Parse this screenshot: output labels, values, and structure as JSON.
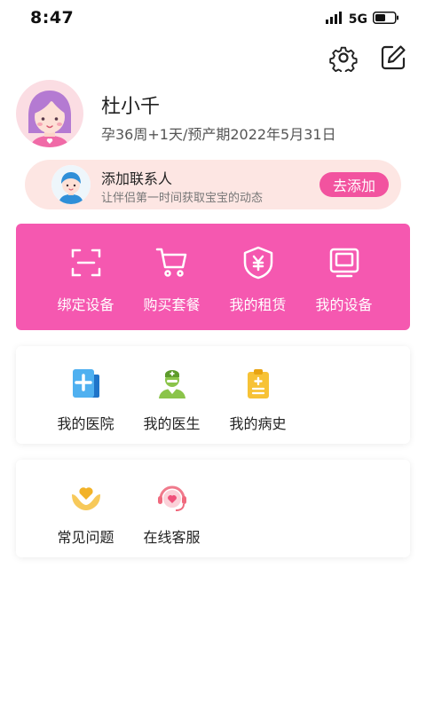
{
  "status_bar": {
    "time": "8:47",
    "network": "5G"
  },
  "header": {
    "icons": [
      "gear-icon",
      "edit-icon"
    ]
  },
  "profile": {
    "name": "杜小千",
    "status": "孕36周+1天/预产期2022年5月31日"
  },
  "contact": {
    "title": "添加联系人",
    "subtitle": "让伴侣第一时间获取宝宝的动态",
    "button": "去添加"
  },
  "services": [
    {
      "label": "绑定设备",
      "icon": "scan-icon"
    },
    {
      "label": "购买套餐",
      "icon": "cart-icon"
    },
    {
      "label": "我的租赁",
      "icon": "rental-shield-icon"
    },
    {
      "label": "我的设备",
      "icon": "monitor-icon"
    }
  ],
  "medical": [
    {
      "label": "我的医院",
      "icon": "hospital-icon"
    },
    {
      "label": "我的医生",
      "icon": "doctor-icon"
    },
    {
      "label": "我的病史",
      "icon": "clipboard-icon"
    }
  ],
  "help": [
    {
      "label": "常见问题",
      "icon": "heart-hands-icon"
    },
    {
      "label": "在线客服",
      "icon": "headset-icon"
    }
  ],
  "colors": {
    "accent": "#f558b0",
    "button": "#f2539f",
    "banner_bg": "#fde6e3"
  }
}
